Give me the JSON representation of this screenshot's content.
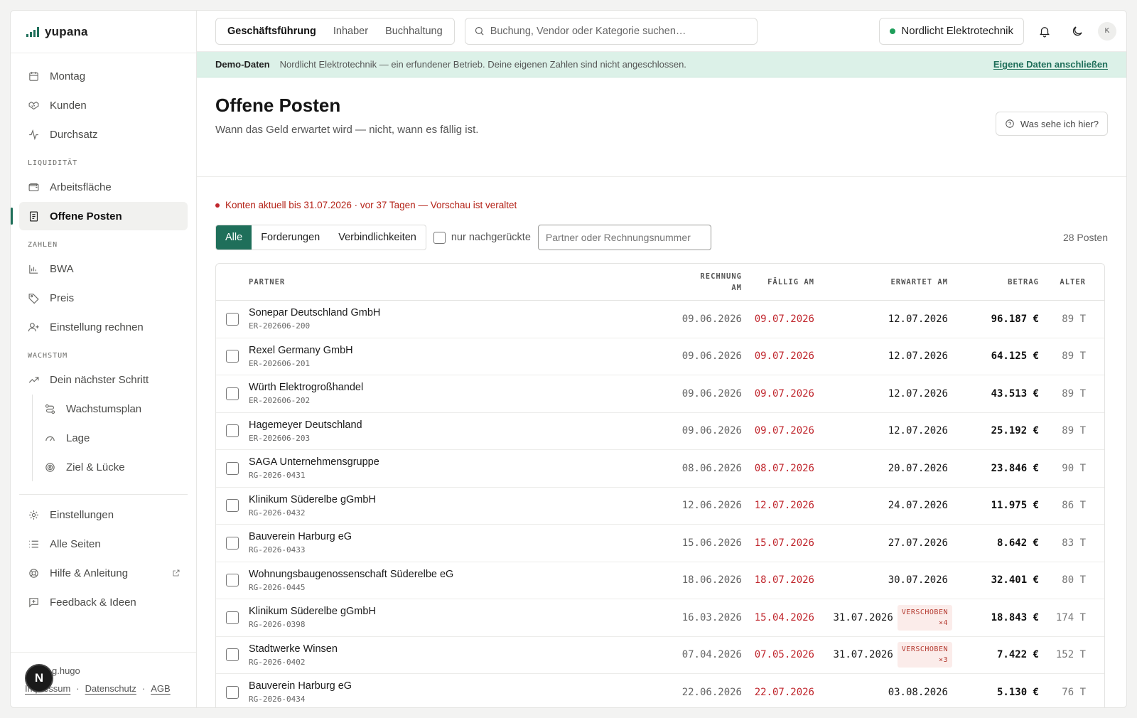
{
  "brand": {
    "name": "yupana"
  },
  "sidebar": {
    "top_items": [
      {
        "label": "Montag",
        "icon": "calendar-icon"
      },
      {
        "label": "Kunden",
        "icon": "handshake-icon"
      },
      {
        "label": "Durchsatz",
        "icon": "activity-icon"
      }
    ],
    "section_liquiditaet": "LIQUIDITÄT",
    "liquiditaet_items": [
      {
        "label": "Arbeitsfläche",
        "icon": "wallet-icon"
      },
      {
        "label": "Offene Posten",
        "icon": "receipt-icon",
        "active": true
      }
    ],
    "section_zahlen": "ZAHLEN",
    "zahlen_items": [
      {
        "label": "BWA",
        "icon": "bar-chart-icon"
      },
      {
        "label": "Preis",
        "icon": "tag-icon"
      },
      {
        "label": "Einstellung rechnen",
        "icon": "user-plus-icon"
      }
    ],
    "section_wachstum": "WACHSTUM",
    "wachstum_items": [
      {
        "label": "Dein nächster Schritt",
        "icon": "trending-up-icon"
      },
      {
        "label": "Wachstumsplan",
        "icon": "route-icon"
      },
      {
        "label": "Lage",
        "icon": "gauge-icon"
      },
      {
        "label": "Ziel & Lücke",
        "icon": "target-icon"
      }
    ],
    "bottom_items": [
      {
        "label": "Einstellungen",
        "icon": "gear-icon"
      },
      {
        "label": "Alle Seiten",
        "icon": "list-icon"
      },
      {
        "label": "Hilfe & Anleitung",
        "icon": "lifebuoy-icon"
      },
      {
        "label": "Feedback & Ideen",
        "icon": "message-plus-icon"
      }
    ],
    "footer": {
      "user": "g.hugo",
      "badge": "N",
      "links": [
        "Impressum",
        "Datenschutz",
        "AGB"
      ],
      "separator": "·"
    }
  },
  "topbar": {
    "role_tabs": [
      "Geschäftsführung",
      "Inhaber",
      "Buchhaltung"
    ],
    "active_role": "Geschäftsführung",
    "search_placeholder": "Buchung, Vendor oder Kategorie suchen…",
    "company": "Nordlicht Elektrotechnik",
    "avatar": "K"
  },
  "banner": {
    "title": "Demo-Daten",
    "text": "Nordlicht Elektrotechnik — ein erfundener Betrieb. Deine eigenen Zahlen sind nicht angeschlossen.",
    "link": "Eigene Daten anschließen"
  },
  "page": {
    "title": "Offene Posten",
    "subtitle": "Wann das Geld erwartet wird — nicht, wann es fällig ist.",
    "help": "Was sehe ich hier?"
  },
  "warning": "Konten aktuell bis 31.07.2026 · vor 37 Tagen — Vorschau ist veraltet",
  "filters": {
    "segments": [
      "Alle",
      "Forderungen",
      "Verbindlichkeiten"
    ],
    "active": "Alle",
    "checkbox_label": "nur nachgerückte",
    "input_placeholder": "Partner oder Rechnungsnummer",
    "count": "28 Posten"
  },
  "table": {
    "headers": {
      "partner": "PARTNER",
      "rechnung_line1": "RECHNUNG",
      "rechnung_line2": "AM",
      "faellig": "FÄLLIG AM",
      "erwartet": "ERWARTET AM",
      "betrag": "BETRAG",
      "alter": "ALTER"
    },
    "shift_label": "VERSCHOBEN",
    "rows": [
      {
        "partner": "Sonepar Deutschland GmbH",
        "ref": "ER-202606-200",
        "rechnung": "09.06.2026",
        "faellig": "09.07.2026",
        "erwartet": "12.07.2026",
        "betrag": "96.187 €",
        "alter": "89 T"
      },
      {
        "partner": "Rexel Germany GmbH",
        "ref": "ER-202606-201",
        "rechnung": "09.06.2026",
        "faellig": "09.07.2026",
        "erwartet": "12.07.2026",
        "betrag": "64.125 €",
        "alter": "89 T"
      },
      {
        "partner": "Würth Elektrogroßhandel",
        "ref": "ER-202606-202",
        "rechnung": "09.06.2026",
        "faellig": "09.07.2026",
        "erwartet": "12.07.2026",
        "betrag": "43.513 €",
        "alter": "89 T"
      },
      {
        "partner": "Hagemeyer Deutschland",
        "ref": "ER-202606-203",
        "rechnung": "09.06.2026",
        "faellig": "09.07.2026",
        "erwartet": "12.07.2026",
        "betrag": "25.192 €",
        "alter": "89 T"
      },
      {
        "partner": "SAGA Unternehmensgruppe",
        "ref": "RG-2026-0431",
        "rechnung": "08.06.2026",
        "faellig": "08.07.2026",
        "erwartet": "20.07.2026",
        "betrag": "23.846 €",
        "alter": "90 T"
      },
      {
        "partner": "Klinikum Süderelbe gGmbH",
        "ref": "RG-2026-0432",
        "rechnung": "12.06.2026",
        "faellig": "12.07.2026",
        "erwartet": "24.07.2026",
        "betrag": "11.975 €",
        "alter": "86 T"
      },
      {
        "partner": "Bauverein Harburg eG",
        "ref": "RG-2026-0433",
        "rechnung": "15.06.2026",
        "faellig": "15.07.2026",
        "erwartet": "27.07.2026",
        "betrag": "8.642 €",
        "alter": "83 T"
      },
      {
        "partner": "Wohnungsbaugenossenschaft Süderelbe eG",
        "ref": "RG-2026-0445",
        "rechnung": "18.06.2026",
        "faellig": "18.07.2026",
        "erwartet": "30.07.2026",
        "betrag": "32.401 €",
        "alter": "80 T"
      },
      {
        "partner": "Klinikum Süderelbe gGmbH",
        "ref": "RG-2026-0398",
        "rechnung": "16.03.2026",
        "faellig": "15.04.2026",
        "erwartet": "31.07.2026",
        "shift": "×4",
        "betrag": "18.843 €",
        "alter": "174 T"
      },
      {
        "partner": "Stadtwerke Winsen",
        "ref": "RG-2026-0402",
        "rechnung": "07.04.2026",
        "faellig": "07.05.2026",
        "erwartet": "31.07.2026",
        "shift": "×3",
        "betrag": "7.422 €",
        "alter": "152 T"
      },
      {
        "partner": "Bauverein Harburg eG",
        "ref": "RG-2026-0434",
        "rechnung": "22.06.2026",
        "faellig": "22.07.2026",
        "erwartet": "03.08.2026",
        "betrag": "5.130 €",
        "alter": "76 T"
      }
    ]
  },
  "colors": {
    "accent": "#1f6f5a",
    "danger": "#c0262d",
    "banner": "#dcf1e8"
  }
}
